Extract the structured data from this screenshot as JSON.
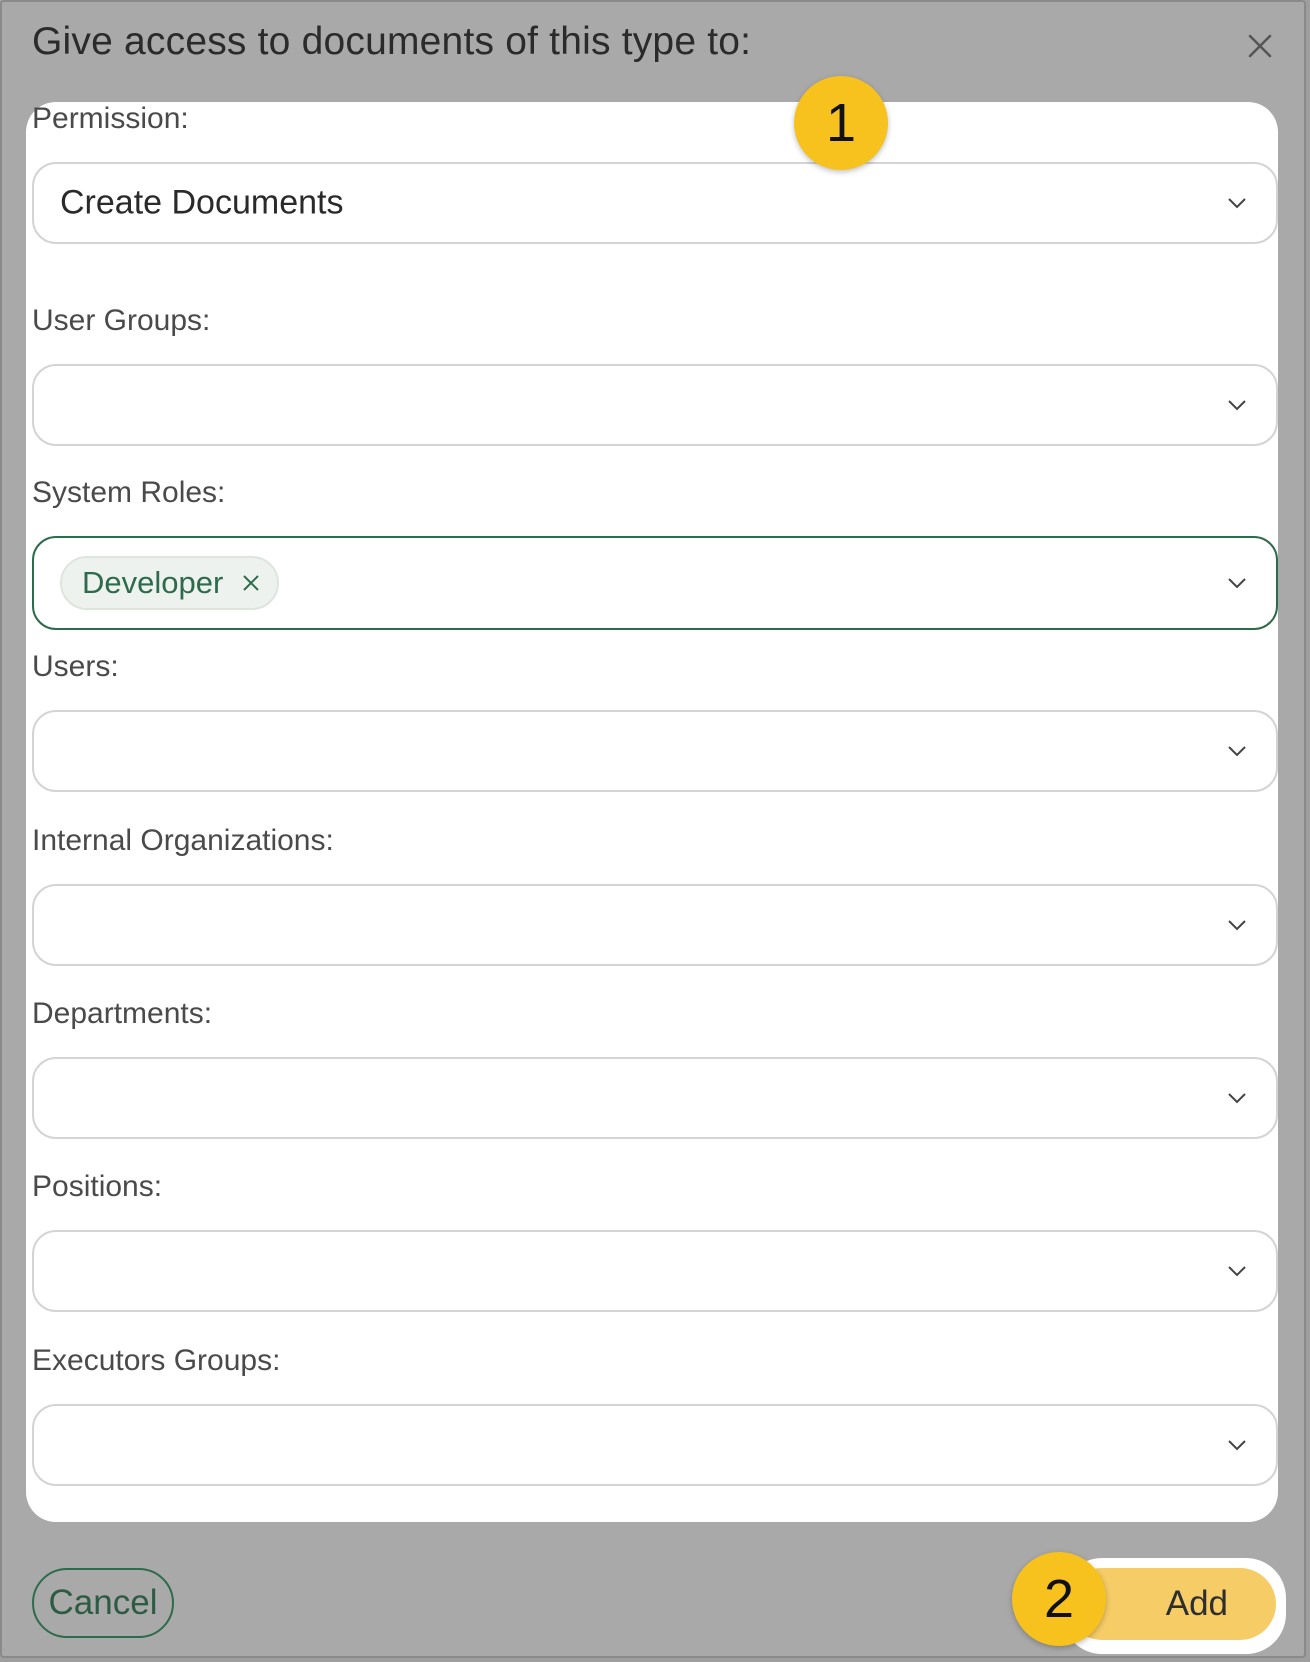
{
  "dialog": {
    "title": "Give access to documents of this type to:"
  },
  "fields": {
    "permission": {
      "label": "Permission:",
      "value": "Create Documents"
    },
    "user_groups": {
      "label": "User Groups:",
      "value": ""
    },
    "system_roles": {
      "label": "System Roles:",
      "chips": [
        "Developer"
      ]
    },
    "users": {
      "label": "Users:",
      "value": ""
    },
    "internal_organizations": {
      "label": "Internal Organizations:",
      "value": ""
    },
    "departments": {
      "label": "Departments:",
      "value": ""
    },
    "positions": {
      "label": "Positions:",
      "value": ""
    },
    "executors_groups": {
      "label": "Executors Groups:",
      "value": ""
    }
  },
  "footer": {
    "cancel_label": "Cancel",
    "add_label": "Add"
  },
  "annotations": {
    "badge_1": "1",
    "badge_2": "2"
  },
  "colors": {
    "accent_green": "#2e6b4c",
    "add_button": "#f6cc67",
    "badge": "#f7c21d",
    "backdrop": "#a9a9a9"
  },
  "icons": [
    "close-icon",
    "chevron-down-icon",
    "chip-remove-icon"
  ]
}
